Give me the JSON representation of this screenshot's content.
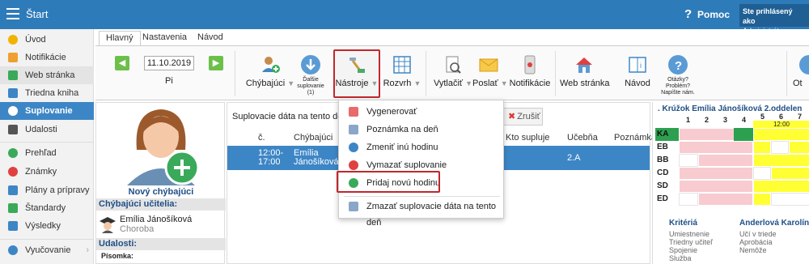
{
  "app": {
    "title": "Štart",
    "help": "Pomoc",
    "user_label": "Ste prihlásený ako",
    "user_role": "Administrátor"
  },
  "colors": {
    "topbar": "#2e7bb9",
    "accent": "#3d86c6",
    "highlight": "#c0272d"
  },
  "sidebar": {
    "items": [
      {
        "label": "Úvod",
        "icon": "star-icon"
      },
      {
        "label": "Notifikácie",
        "icon": "envelope-icon"
      },
      {
        "label": "Web stránka",
        "icon": "home-icon"
      },
      {
        "label": "Triedna kniha",
        "icon": "book-icon"
      },
      {
        "label": "Suplovanie",
        "icon": "person-icon",
        "active": true
      },
      {
        "label": "Udalosti",
        "icon": "calendar-icon"
      },
      {
        "label": "Prehľad",
        "icon": "check-icon"
      },
      {
        "label": "Známky",
        "icon": "grades-icon"
      },
      {
        "label": "Plány a prípravy",
        "icon": "folder-icon"
      },
      {
        "label": "Štandardy",
        "icon": "shield-icon"
      },
      {
        "label": "Výsledky",
        "icon": "bar-chart-icon"
      },
      {
        "label": "Vyučovanie",
        "icon": "globe-icon"
      }
    ]
  },
  "tabs": [
    "Hlavný",
    "Nastavenia",
    "Návod"
  ],
  "ribbon": {
    "date": "11.10.2019",
    "day": "Pi",
    "buttons": {
      "absent": "Chýbajúci",
      "more": "Ďalšie suplovanie (1)",
      "tools": "Nástroje",
      "schedule": "Rozvrh",
      "print": "Vytlačiť",
      "send": "Poslať",
      "notify": "Notifikácie",
      "web": "Web stránka",
      "guide": "Návod",
      "questions": "Otázky? Problém? Napíšte nám.",
      "other": "Ot"
    }
  },
  "left_panel": {
    "new_absent": "Nový chýbajúci",
    "absent_teachers_header": "Chýbajúci učitelia:",
    "teacher": {
      "name": "Emília Jánošíková",
      "reason": "Choroba"
    },
    "events_header": "Udalosti:",
    "events_sub": "Písomka:"
  },
  "table": {
    "title": "Suplovacie dáta na tento deň e",
    "cancel": "Zrušiť",
    "headers": [
      "č.",
      "Chýbajúci",
      "Kto supluje",
      "Učebňa",
      "Poznámka"
    ],
    "row": {
      "time": "12:00- 17:00",
      "absent": "Emília Jánošíková",
      "room": "2.A"
    }
  },
  "menu": {
    "items": [
      {
        "label": "Vygenerovať",
        "icon": "generate-icon"
      },
      {
        "label": "Poznámka na deň",
        "icon": "note-icon"
      },
      {
        "label": "Zmeniť inú hodinu",
        "icon": "refresh-icon"
      },
      {
        "label": "Vymazať suplovanie",
        "icon": "delete-icon"
      },
      {
        "label": "Pridaj novú hodinu",
        "icon": "add-icon",
        "highlighted": true
      },
      {
        "label": "Zmazať suplovacie dáta na tento deň",
        "icon": "erase-icon"
      }
    ]
  },
  "grid": {
    "title": ". Krúžok Emília Jánošíková 2.oddelen",
    "periods": [
      "1",
      "2",
      "3",
      "4",
      "5",
      "6",
      "7"
    ],
    "time": "12:00",
    "rows": [
      "KA",
      "EB",
      "BB",
      "CD",
      "SD",
      "ED"
    ],
    "criteria_header": "Kritériá",
    "criteria": [
      "Umiestnenie",
      "Triedny učiteľ",
      "Spojenie",
      "Služba"
    ],
    "teacher_header": "Anderlová Karolína",
    "teacher_notes": [
      "Učí v triede",
      "Aprobácia",
      "Nemôže"
    ]
  }
}
